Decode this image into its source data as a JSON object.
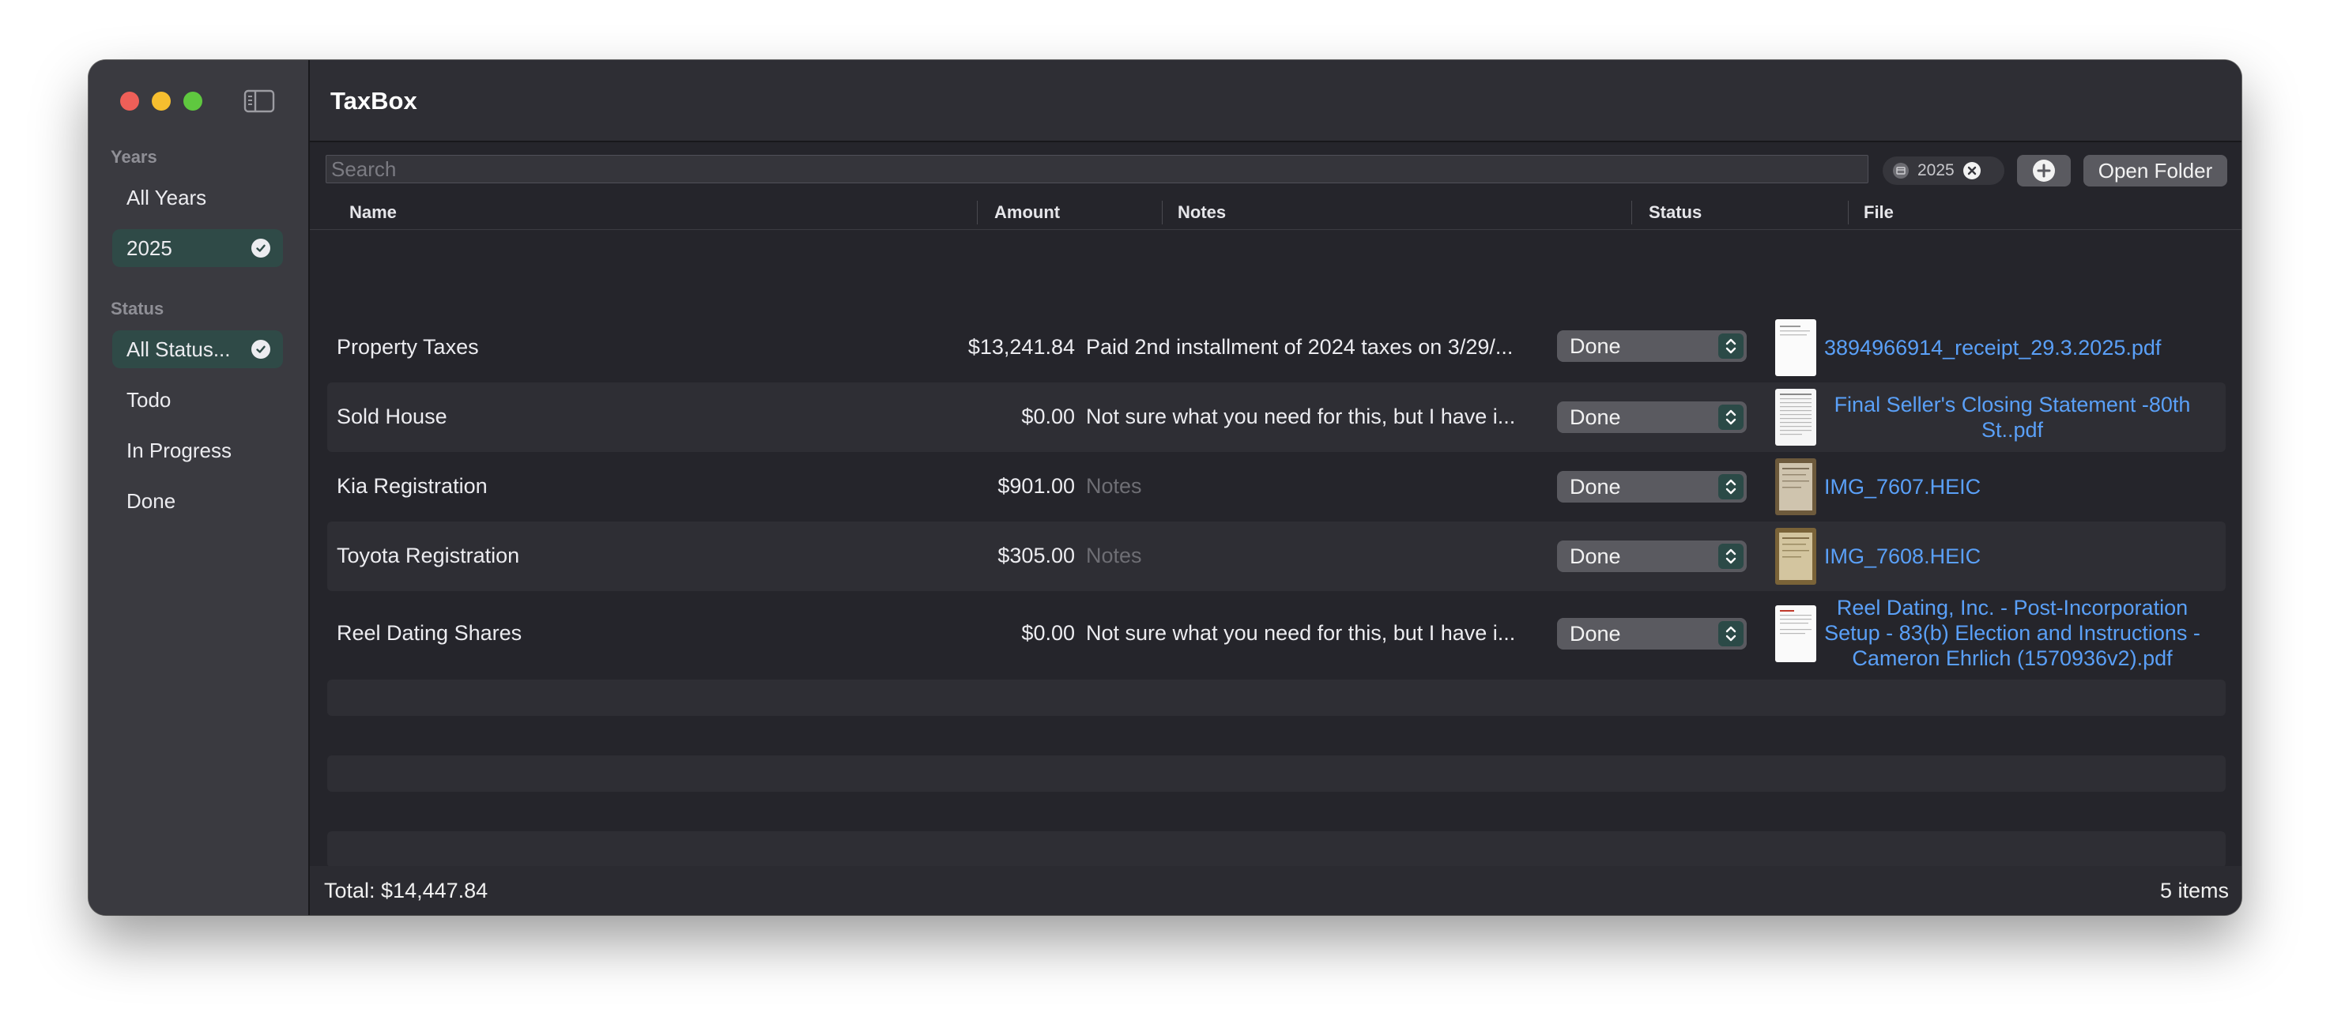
{
  "app": {
    "title": "TaxBox"
  },
  "sidebar": {
    "years_title": "Years",
    "years": [
      {
        "label": "All Years",
        "selected": false
      },
      {
        "label": "2025",
        "selected": true
      }
    ],
    "status_title": "Status",
    "statuses": [
      {
        "label": "All Status...",
        "selected": true
      },
      {
        "label": "Todo",
        "selected": false
      },
      {
        "label": "In Progress",
        "selected": false
      },
      {
        "label": "Done",
        "selected": false
      }
    ]
  },
  "toolbar": {
    "search_placeholder": "Search",
    "year_token": "2025",
    "open_folder_label": "Open Folder"
  },
  "table": {
    "columns": [
      "Name",
      "Amount",
      "Notes",
      "Status",
      "File"
    ],
    "rows": [
      {
        "name": "Property Taxes",
        "amount": "$13,241.84",
        "notes": "Paid 2nd installment of 2024 taxes on 3/29/...",
        "notes_is_placeholder": false,
        "status": "Done",
        "file": "3894966914_receipt_29.3.2025.pdf",
        "thumb": "receipt"
      },
      {
        "name": "Sold House",
        "amount": "$0.00",
        "notes": "Not sure what you need for this, but I have i...",
        "notes_is_placeholder": false,
        "status": "Done",
        "file": "Final Seller's Closing Statement -80th St..pdf",
        "thumb": "document"
      },
      {
        "name": "Kia Registration",
        "amount": "$901.00",
        "notes": "Notes",
        "notes_is_placeholder": true,
        "status": "Done",
        "file": "IMG_7607.HEIC",
        "thumb": "photo"
      },
      {
        "name": "Toyota Registration",
        "amount": "$305.00",
        "notes": "Notes",
        "notes_is_placeholder": true,
        "status": "Done",
        "file": "IMG_7608.HEIC",
        "thumb": "photo"
      },
      {
        "name": "Reel Dating Shares",
        "amount": "$0.00",
        "notes": "Not sure what you need for this, but I have i...",
        "notes_is_placeholder": false,
        "status": "Done",
        "file": "Reel Dating, Inc. - Post-Incorporation Setup - 83(b) Election and Instructions - Cameron Ehrlich (1570936v2).pdf",
        "thumb": "document"
      }
    ]
  },
  "footer": {
    "total": "Total: $14,447.84",
    "count": "5 items"
  },
  "colors": {
    "accent_selection": "#2f4a47",
    "link": "#5aa0f8",
    "window_bg": "#25252b",
    "sidebar_bg": "#3a3a40"
  }
}
